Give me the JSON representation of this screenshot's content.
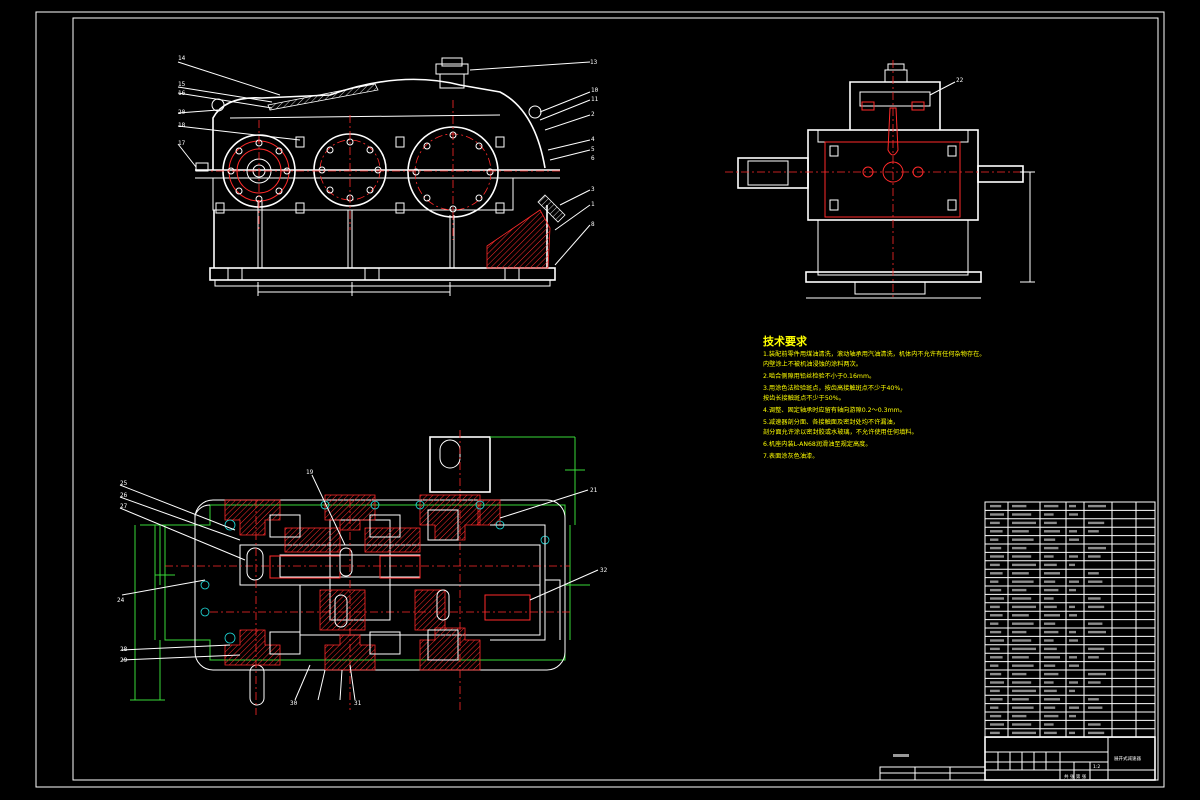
{
  "drawing": {
    "tech_requirements": {
      "title": "技术要求",
      "lines": [
        "1.装配前零件用煤油清洗，滚动轴承用汽油清洗，机体内不允许有任何杂物存在。",
        "  内壁涂上不被机油浸蚀的涂料两次。",
        "2.啮合侧隙用铅丝检验不小于0.16mm。",
        "3.用涂色法检验斑点，按齿高接触斑点不少于40%，",
        "  按齿长接触斑点不少于50%。",
        "4.调整、固定轴承时应留有轴向游隙0.2～0.3mm。",
        "5.减速器剖分面、各接触面及密封处均不许漏油，",
        "  剖分面允许涂以密封胶或水玻璃，不允许使用任何填料。",
        "6.机座内装L-AN68润滑油至规定高度。",
        "7.表面涂灰色油漆。"
      ]
    },
    "part_callouts": {
      "front": [
        "14",
        "15",
        "16",
        "20",
        "18",
        "17",
        "13",
        "10",
        "11",
        "2",
        "4",
        "5",
        "6",
        "3",
        "1",
        "8"
      ],
      "side": [
        "22"
      ],
      "plan": [
        "21",
        "32",
        "19",
        "24",
        "25",
        "26",
        "27",
        "28",
        "29",
        "30",
        "31"
      ]
    },
    "title_block": {
      "drawing_name": "展开式减速器",
      "scale": "1:2",
      "sheet_label": "共 张 第 张"
    }
  }
}
